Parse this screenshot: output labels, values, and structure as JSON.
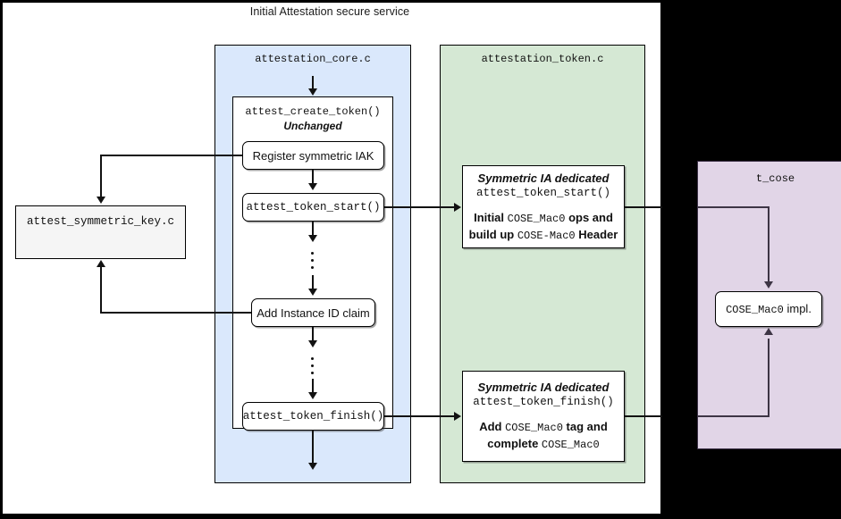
{
  "diagram": {
    "title": "Initial Attestation secure service",
    "background_color": "#000000",
    "modules": {
      "core": {
        "title": "attestation_core.c",
        "color": "#dae8fc",
        "inner": {
          "title": "attest_create_token()",
          "subtitle": "Unchanged",
          "nodes": [
            {
              "label": "Register symmetric IAK",
              "style": "sans"
            },
            {
              "label": "attest_token_start()",
              "style": "mono"
            },
            {
              "label": "Add Instance ID claim",
              "style": "sans"
            },
            {
              "label": "attest_token_finish()",
              "style": "mono"
            }
          ]
        }
      },
      "token": {
        "title": "attestation_token.c",
        "color": "#d5e8d4",
        "boxes": [
          {
            "emphasis": "Symmetric IA dedicated",
            "function": "attest_token_start()",
            "body_line1_pre": "Initial ",
            "body_line1_mono": "COSE_Mac0",
            "body_line1_post": " ops and",
            "body_line2_pre": "build up ",
            "body_line2_mono": "COSE-Mac0",
            "body_line2_post": " Header"
          },
          {
            "emphasis": "Symmetric IA dedicated",
            "function": "attest_token_finish()",
            "body_line1_pre": "Add ",
            "body_line1_mono": "COSE_Mac0",
            "body_line1_post": " tag and",
            "body_line2_pre": "complete ",
            "body_line2_mono": "COSE_Mac0",
            "body_line2_post": ""
          }
        ]
      },
      "tcose": {
        "title": "t_cose",
        "color": "#e1d5e7",
        "node_mono": "COSE_Mac0",
        "node_rest": " impl."
      },
      "symmetric_key": {
        "title": "attest_symmetric_key.c",
        "color": "#f5f5f5"
      }
    }
  }
}
